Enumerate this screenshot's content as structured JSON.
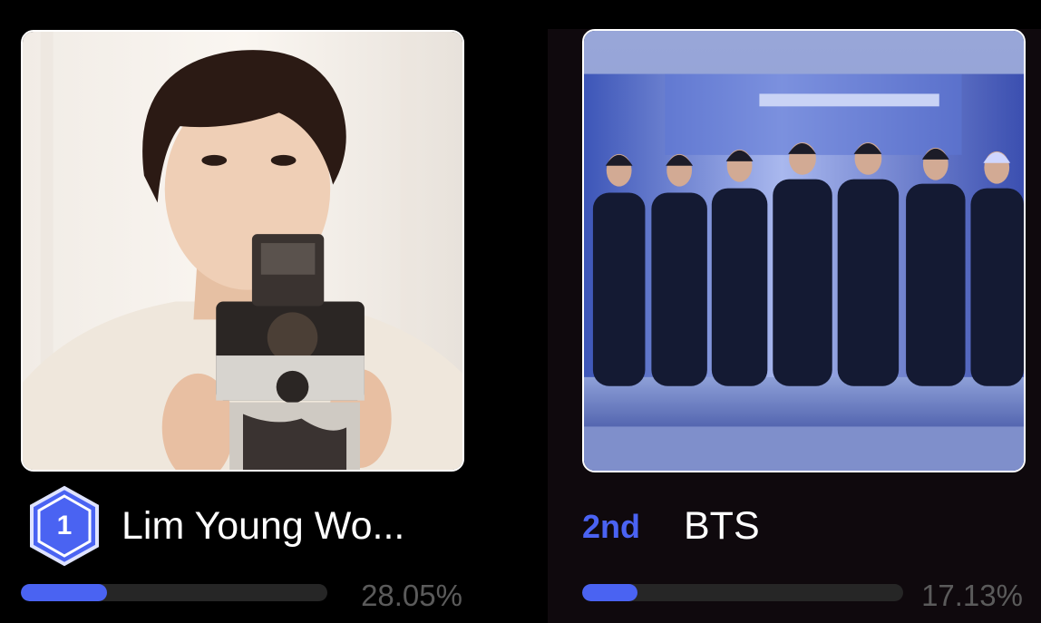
{
  "colors": {
    "accent": "#4a63f2",
    "track": "#262626",
    "percent_text": "#5b5b5b",
    "badge_fill": "#4a63f2",
    "badge_stroke": "#dfe3ff"
  },
  "entries": [
    {
      "rank": "1",
      "name": "Lim Young Wo...",
      "percent": "28.05%",
      "share": 0.2805,
      "photo_icon": "artist-photo-camera-portrait"
    },
    {
      "rank": "2nd",
      "name": "BTS",
      "percent": "17.13%",
      "share": 0.1713,
      "photo_icon": "group-photo-vault"
    }
  ]
}
